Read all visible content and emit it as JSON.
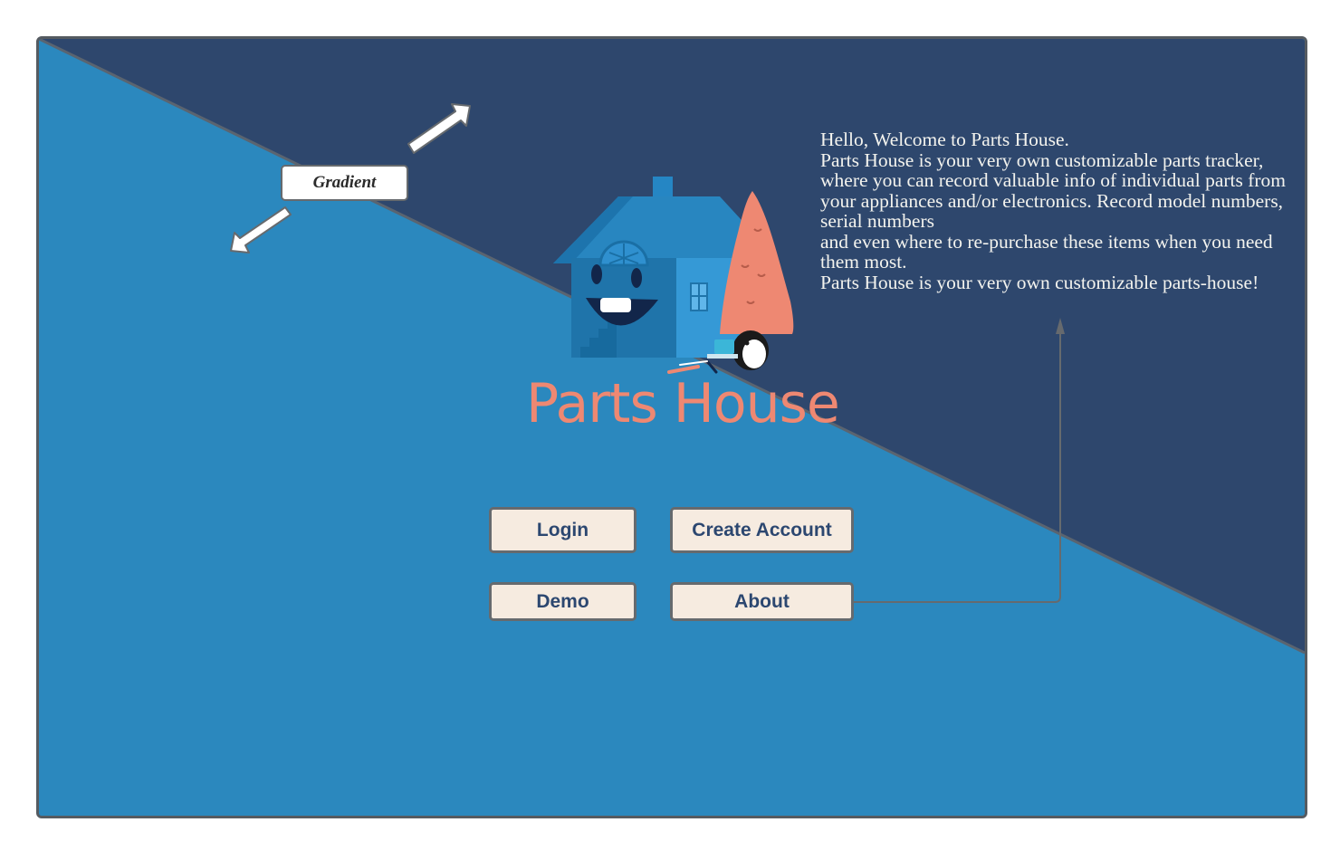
{
  "app": {
    "title": "Parts House"
  },
  "welcome": {
    "lines": [
      "Hello, Welcome to Parts House.",
      "Parts House is your very own customizable parts tracker, where you can record valuable info of individual parts from your appliances and/or electronics. Record model numbers, serial numbers",
      "and even where to re-purchase these items when you need them most.",
      "Parts House is your very own customizable parts-house!"
    ]
  },
  "buttons": {
    "login": "Login",
    "create_account": "Create Account",
    "demo": "Demo",
    "about": "About"
  },
  "annotations": {
    "gradient_label": "Gradient"
  },
  "colors": {
    "background_light": "#2b88be",
    "background_dark": "#2e476d",
    "title": "#ee8872",
    "button_bg": "#f6ebe0",
    "button_text": "#2c4770"
  }
}
